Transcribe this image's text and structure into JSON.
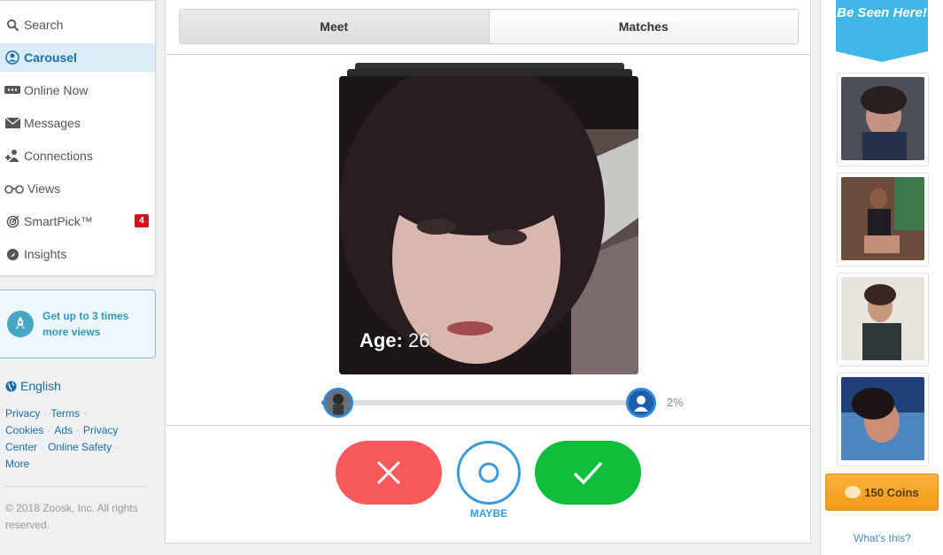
{
  "nav": {
    "items": [
      {
        "label": "Search",
        "icon": "search-icon"
      },
      {
        "label": "Carousel",
        "icon": "carousel-icon",
        "active": true
      },
      {
        "label": "Online Now",
        "icon": "online-now-icon"
      },
      {
        "label": "Messages",
        "icon": "envelope-icon"
      },
      {
        "label": "Connections",
        "icon": "connections-icon"
      },
      {
        "label": "Views",
        "icon": "glasses-icon"
      },
      {
        "label": "SmartPick™",
        "icon": "target-icon",
        "badge": "4"
      },
      {
        "label": "Insights",
        "icon": "insights-icon"
      }
    ]
  },
  "promo": {
    "text": "Get up to 3 times more views",
    "icon": "rocket-icon"
  },
  "language": {
    "label": "English",
    "icon": "globe-icon"
  },
  "footer": {
    "links": [
      "Privacy",
      "Terms",
      "Cookies",
      "Ads",
      "Privacy Center",
      "Online Safety",
      "More"
    ],
    "copyright": "© 2018 Zoosk, Inc. All rights reserved."
  },
  "tabs": [
    {
      "label": "Meet",
      "active": true
    },
    {
      "label": "Matches",
      "active": false
    }
  ],
  "profile": {
    "age_label": "Age:",
    "age_value": "26"
  },
  "progress": {
    "percent_text": "2%",
    "value": 0.02
  },
  "actions": {
    "no_icon": "close-icon",
    "maybe_icon": "circle-icon",
    "maybe_label": "MAYBE",
    "yes_icon": "check-icon"
  },
  "right": {
    "banner": "Be Seen Here!",
    "coins_label": "150 Coins",
    "whats_this": "What's this?"
  },
  "colors": {
    "accent_blue": "#2e8ad6",
    "no_red": "#f85a5c",
    "yes_green": "#0ebd3a",
    "badge_red": "#d0141c",
    "coins_orange": "#f39a18",
    "banner_blue": "#3fb8e8"
  }
}
